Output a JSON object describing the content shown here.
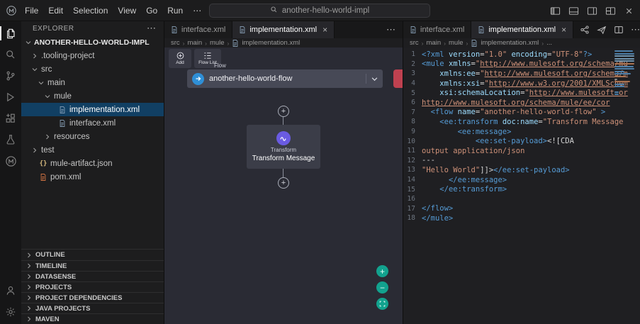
{
  "colors": {
    "accent_blue": "#2f8fd6",
    "node_purple": "#6a5be2",
    "error_red": "#bf4150",
    "zoom_teal": "#12a28e",
    "selection_blue": "#113f63",
    "tag_blue": "#569cd6",
    "attr_blue": "#9cdcfe",
    "string_orange": "#ce9178"
  },
  "title_bar": {
    "menus": [
      "File",
      "Edit",
      "Selection",
      "View",
      "Go",
      "Run",
      "⋯"
    ],
    "search_text": "another-hello-world-impl"
  },
  "activity_bar": {
    "top": [
      {
        "name": "explorer",
        "active": true
      },
      {
        "name": "search"
      },
      {
        "name": "source-control"
      },
      {
        "name": "run-debug"
      },
      {
        "name": "extensions"
      },
      {
        "name": "testing"
      },
      {
        "name": "mulesoft"
      }
    ],
    "bottom": [
      {
        "name": "accounts"
      },
      {
        "name": "settings"
      }
    ]
  },
  "sidebar": {
    "title": "EXPLORER",
    "root": "ANOTHER-HELLO-WORLD-IMPL",
    "tree": [
      {
        "label": ".tooling-project",
        "level": 1,
        "kind": "collapsed"
      },
      {
        "label": "src",
        "level": 1,
        "kind": "expanded"
      },
      {
        "label": "main",
        "level": 2,
        "kind": "expanded"
      },
      {
        "label": "mule",
        "level": 3,
        "kind": "expanded"
      },
      {
        "label": "implementation.xml",
        "level": 4,
        "kind": "file",
        "icon": "xml",
        "selected": true
      },
      {
        "label": "interface.xml",
        "level": 4,
        "kind": "file",
        "icon": "xml"
      },
      {
        "label": "resources",
        "level": 3,
        "kind": "collapsed"
      },
      {
        "label": "test",
        "level": 1,
        "kind": "collapsed"
      },
      {
        "label": "mule-artifact.json",
        "level": 1,
        "kind": "file",
        "icon": "json"
      },
      {
        "label": "pom.xml",
        "level": 1,
        "kind": "file",
        "icon": "pom"
      }
    ],
    "sections": [
      "OUTLINE",
      "TIMELINE",
      "DATASENSE",
      "PROJECTS",
      "PROJECT DEPENDENCIES",
      "JAVA PROJECTS",
      "MAVEN"
    ]
  },
  "center_editor": {
    "tabs": [
      {
        "label": "interface.xml",
        "active": false
      },
      {
        "label": "implementation.xml",
        "active": true
      }
    ],
    "actions": [
      {
        "name": "more-actions"
      }
    ],
    "breadcrumb": [
      {
        "label": "src"
      },
      {
        "label": "main"
      },
      {
        "label": "mule"
      },
      {
        "label": "implementation.xml",
        "icon": true
      }
    ],
    "toolbar": {
      "add_label": "Add",
      "flow_list_label": "Flow List"
    },
    "flow": {
      "badge": "Flow",
      "name": "another-hello-world-flow"
    },
    "node": {
      "type": "Transform",
      "name": "Transform Message"
    },
    "plus_glyph": "+",
    "zoom": {
      "in": "+",
      "out": "−"
    }
  },
  "right_editor": {
    "tabs": [
      {
        "label": "interface.xml",
        "active": false
      },
      {
        "label": "implementation.xml",
        "active": true
      }
    ],
    "actions": [
      {
        "name": "flow-graph"
      },
      {
        "name": "publish"
      },
      {
        "name": "split-editor"
      },
      {
        "name": "more-actions"
      }
    ],
    "breadcrumb": [
      {
        "label": "src"
      },
      {
        "label": "main"
      },
      {
        "label": "mule"
      },
      {
        "label": "implementation.xml",
        "icon": true
      },
      {
        "label": "..."
      }
    ],
    "lines": [
      [
        {
          "c": "t",
          "t": "<?xml "
        },
        {
          "c": "a",
          "t": "version"
        },
        {
          "c": "p",
          "t": "="
        },
        {
          "c": "s",
          "t": "\"1.0\""
        },
        {
          "c": "a",
          "t": " encoding"
        },
        {
          "c": "p",
          "t": "="
        },
        {
          "c": "s",
          "t": "\"UTF-8\""
        },
        {
          "c": "t",
          "t": "?>"
        }
      ],
      [
        {
          "c": "t",
          "t": "<mule "
        },
        {
          "c": "a",
          "t": "xmlns"
        },
        {
          "c": "p",
          "t": "="
        },
        {
          "c": "s",
          "t": "\""
        },
        {
          "c": "l",
          "t": "http://www.mulesoft.org/schema/mu"
        }
      ],
      [
        {
          "c": "p",
          "t": "    "
        },
        {
          "c": "a",
          "t": "xmlns:ee"
        },
        {
          "c": "p",
          "t": "="
        },
        {
          "c": "s",
          "t": "\""
        },
        {
          "c": "l",
          "t": "http://www.mulesoft.org/schema/m"
        }
      ],
      [
        {
          "c": "p",
          "t": "    "
        },
        {
          "c": "a",
          "t": "xmlns:xsi"
        },
        {
          "c": "p",
          "t": "="
        },
        {
          "c": "s",
          "t": "\""
        },
        {
          "c": "l",
          "t": "http://www.w3.org/2001/XMLSchem"
        }
      ],
      [
        {
          "c": "p",
          "t": "    "
        },
        {
          "c": "a",
          "t": "xsi:schemaLocation"
        },
        {
          "c": "p",
          "t": "="
        },
        {
          "c": "s",
          "t": "\""
        },
        {
          "c": "l",
          "t": "http://www.mulesoft.or"
        }
      ],
      [
        {
          "c": "l",
          "t": "http://www.mulesoft.org/schema/mule/ee/cor"
        }
      ],
      [
        {
          "c": "p",
          "t": "  "
        },
        {
          "c": "t",
          "t": "<flow "
        },
        {
          "c": "a",
          "t": "name"
        },
        {
          "c": "p",
          "t": "="
        },
        {
          "c": "s",
          "t": "\"another-hello-world-flow\""
        },
        {
          "c": "t",
          "t": " >"
        }
      ],
      [
        {
          "c": "p",
          "t": "    "
        },
        {
          "c": "t",
          "t": "<ee:transform "
        },
        {
          "c": "a",
          "t": "doc:name"
        },
        {
          "c": "p",
          "t": "="
        },
        {
          "c": "s",
          "t": "\"Transform Message"
        }
      ],
      [
        {
          "c": "p",
          "t": "        "
        },
        {
          "c": "t",
          "t": "<ee:message>"
        }
      ],
      [
        {
          "c": "p",
          "t": "            "
        },
        {
          "c": "t",
          "t": "<ee:set-payload>"
        },
        {
          "c": "p",
          "t": "<![CDA"
        }
      ],
      [
        {
          "c": "s",
          "t": "output application/json"
        }
      ],
      [
        {
          "c": "p",
          "t": "---"
        }
      ],
      [
        {
          "c": "s",
          "t": "\"Hello World\""
        },
        {
          "c": "p",
          "t": "]]>"
        },
        {
          "c": "t",
          "t": "</ee:set-payload>"
        }
      ],
      [
        {
          "c": "p",
          "t": "      "
        },
        {
          "c": "t",
          "t": "</ee:message>"
        }
      ],
      [
        {
          "c": "p",
          "t": "    "
        },
        {
          "c": "t",
          "t": "</ee:transform>"
        }
      ],
      [],
      [
        {
          "c": "t",
          "t": "</flow>"
        }
      ],
      [
        {
          "c": "t",
          "t": "</mule>"
        }
      ]
    ]
  }
}
